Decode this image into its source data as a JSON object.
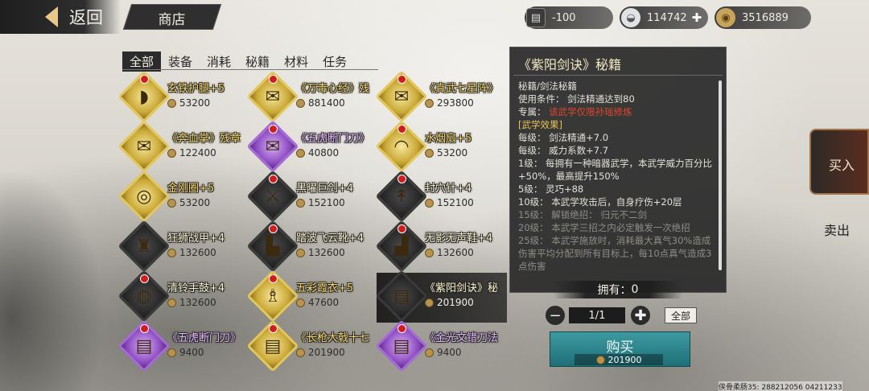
{
  "header": {
    "back_label": "返回",
    "shop_title": "商店",
    "resources": [
      {
        "icon": "cart-icon",
        "value": "-100"
      },
      {
        "icon": "silver-ingot-icon",
        "value": "114742"
      },
      {
        "icon": "coin-icon",
        "value": "3516889"
      }
    ]
  },
  "tabs": [
    "全部",
    "装备",
    "消耗",
    "秘籍",
    "材料",
    "任务"
  ],
  "active_tab": "全部",
  "items": [
    {
      "name": "玄铁护腿+5",
      "price": "53200",
      "rarity": "gold",
      "icon": "leg-guard-icon",
      "new": true
    },
    {
      "name": "《万毒心经》残",
      "price": "881400",
      "rarity": "gold",
      "icon": "scroll-icon",
      "new": true
    },
    {
      "name": "《真武七星阵》",
      "price": "293800",
      "rarity": "gold",
      "icon": "scroll-icon",
      "new": true
    },
    {
      "name": "《奔血掌》残章",
      "price": "122400",
      "rarity": "gold",
      "icon": "scroll-icon",
      "new": false
    },
    {
      "name": "《五虎断门刀》",
      "price": "40800",
      "rarity": "purple",
      "icon": "scroll-icon",
      "new": true
    },
    {
      "name": "水烟扇+5",
      "price": "53200",
      "rarity": "gold",
      "icon": "fan-icon",
      "new": true
    },
    {
      "name": "金刚圈+5",
      "price": "53200",
      "rarity": "gold",
      "icon": "ring-icon",
      "new": false
    },
    {
      "name": "黑曜巨剑+4",
      "price": "152100",
      "rarity": "dark",
      "icon": "sword-icon",
      "new": true
    },
    {
      "name": "封穴针+4",
      "price": "152100",
      "rarity": "dark",
      "icon": "needle-icon",
      "new": true
    },
    {
      "name": "狂狮战甲+4",
      "price": "132600",
      "rarity": "dark",
      "icon": "armor-icon",
      "new": false
    },
    {
      "name": "踏波飞云靴+4",
      "price": "132600",
      "rarity": "dark",
      "icon": "boots-icon",
      "new": true
    },
    {
      "name": "无影无声鞋+4",
      "price": "132600",
      "rarity": "dark",
      "icon": "shoes-icon",
      "new": true
    },
    {
      "name": "清铃手鼓+4",
      "price": "132600",
      "rarity": "dark",
      "icon": "drum-icon",
      "new": true
    },
    {
      "name": "五彩霞衣+5",
      "price": "47600",
      "rarity": "gold",
      "icon": "robe-icon",
      "new": true
    },
    {
      "name": "《紫阳剑诀》秘",
      "price": "201900",
      "rarity": "dark",
      "icon": "book-icon",
      "new": false,
      "selected": true
    },
    {
      "name": "《五虎断门刀》",
      "price": "9400",
      "rarity": "purple",
      "icon": "book-icon",
      "new": true
    },
    {
      "name": "《长枪大戟十七",
      "price": "201900",
      "rarity": "gold",
      "icon": "book-icon",
      "new": true
    },
    {
      "name": "《金光文错刀法",
      "price": "9400",
      "rarity": "purple",
      "icon": "book-icon",
      "new": true
    }
  ],
  "detail": {
    "title": "《紫阳剑诀》秘籍",
    "type_line": "秘籍/剑法秘籍",
    "condition_label": "使用条件：",
    "condition_value": "剑法精通达到80",
    "exclusive_label": "专属：",
    "exclusive_value": "该武学仅限孙瑶修炼",
    "effects_header": "[武学效果]",
    "lines": [
      {
        "text": "每级：  剑法精通+7.0",
        "style": "normal"
      },
      {
        "text": "每级：  威力系数+7.7",
        "style": "normal"
      },
      {
        "text": "1级：   每拥有一种暗器武学，本武学威力百分比+50%，最高提升150%",
        "style": "normal"
      },
      {
        "text": "5级：   灵巧+88",
        "style": "normal"
      },
      {
        "text": "10级：  本武学攻击后，自身疗伤+20层",
        "style": "normal"
      },
      {
        "text": "15级：  解锁绝招：  归元不二剑",
        "style": "grey"
      },
      {
        "text": "20级：  本武学三招之内必定触发一次绝招",
        "style": "grey"
      },
      {
        "text": "25级：  本武学施放时，消耗最大真气30%造成伤害平均分配到所有目标上，每10点真气造成3点伤害",
        "style": "grey"
      }
    ],
    "owned_label": "拥有：",
    "owned_value": "0",
    "qty_value": "1/1",
    "all_label": "全部",
    "buy_label": "购买",
    "buy_price": "201900"
  },
  "side": {
    "buy_label": "买入",
    "sell_label": "卖出"
  },
  "footer": "侠骨柔肠35: 288212056  04211233"
}
